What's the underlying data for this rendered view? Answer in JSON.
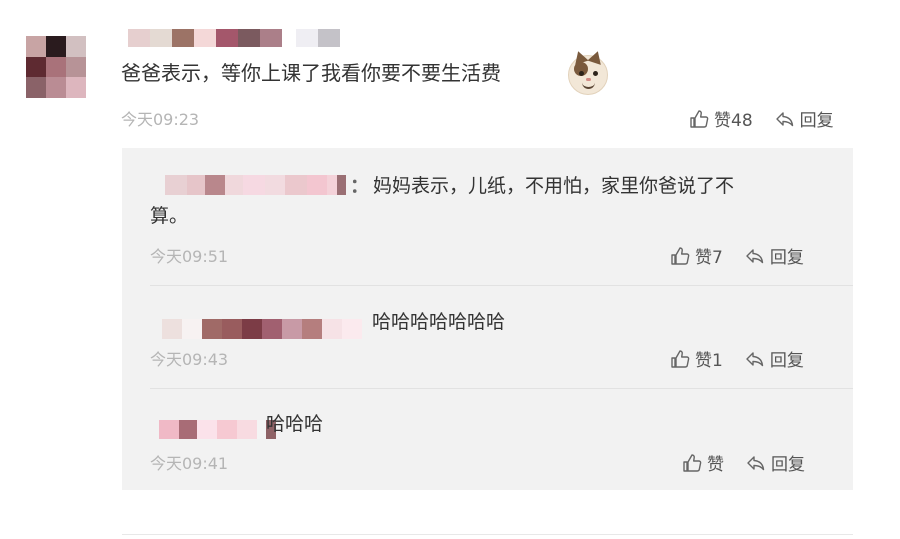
{
  "comment": {
    "username": "",
    "text": "爸爸表示，等你上课了我看你要不要生活费",
    "time": "今天09:23",
    "like_label": "赞48",
    "reply_label": "回复",
    "avatar": "blurred-avatar"
  },
  "replies": [
    {
      "username": "",
      "text_line1": "妈妈表示，儿纸，不用怕，家里你爸说了不",
      "text_line2": "算。",
      "time": "今天09:51",
      "like_label": "赞7",
      "reply_label": "回复"
    },
    {
      "username": "",
      "text": "哈哈哈哈哈哈哈",
      "time": "今天09:43",
      "like_label": "赞1",
      "reply_label": "回复"
    },
    {
      "username": "",
      "text": "哈哈哈",
      "time": "今天09:41",
      "like_label": "赞",
      "reply_label": "回复"
    }
  ],
  "colon": "：",
  "colors": {
    "reply_background": "#f2f2f2",
    "text": "#333333",
    "time": "#b5b5b5",
    "action": "#555555"
  },
  "icons": {
    "like": "thumbs-up-icon",
    "reply": "reply-arrow-icon",
    "emoji": "cat-face-emoji-icon"
  }
}
